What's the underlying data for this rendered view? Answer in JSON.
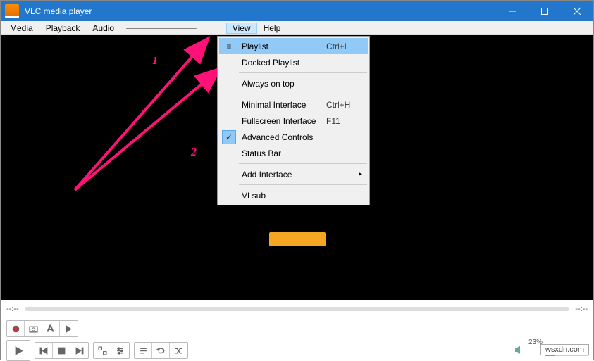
{
  "title": "VLC media player",
  "menubar": {
    "items": [
      "Media",
      "Playback",
      "Audio"
    ],
    "view": "View",
    "help": "Help"
  },
  "dropdown": {
    "groups": [
      [
        {
          "label": "Playlist",
          "shortcut": "Ctrl+L",
          "icon": "playlist",
          "hl": true
        },
        {
          "label": "Docked Playlist",
          "checked": false
        }
      ],
      [
        {
          "label": "Always on top"
        }
      ],
      [
        {
          "label": "Minimal Interface",
          "shortcut": "Ctrl+H"
        },
        {
          "label": "Fullscreen Interface",
          "shortcut": "F11"
        },
        {
          "label": "Advanced Controls",
          "checked": true
        },
        {
          "label": "Status Bar"
        }
      ],
      [
        {
          "label": "Add Interface",
          "submenu": true
        }
      ],
      [
        {
          "label": "VLsub"
        }
      ]
    ]
  },
  "annotations": {
    "one": "1",
    "two": "2"
  },
  "time": {
    "left": "--:--",
    "right": "--:--"
  },
  "volume": {
    "percent": "23%"
  },
  "watermark": "wsxdn.com"
}
